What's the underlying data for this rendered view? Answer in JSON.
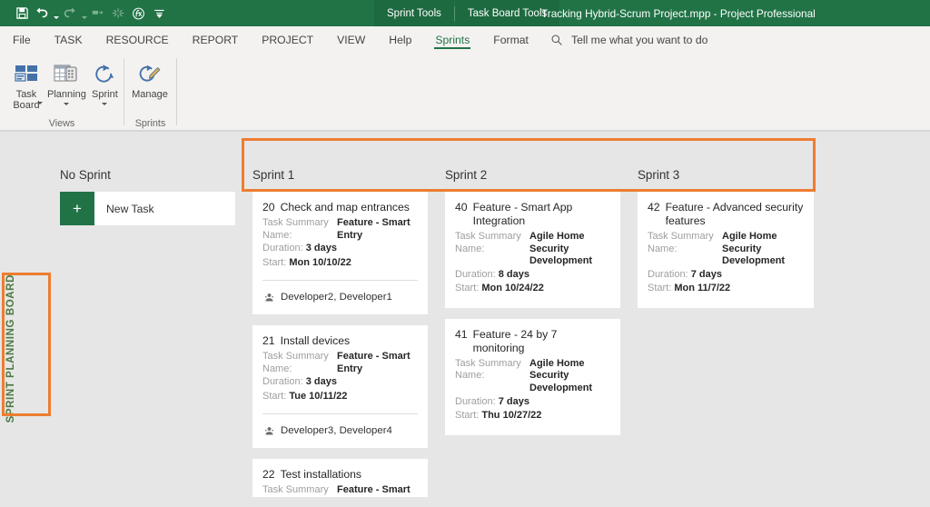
{
  "titlebar": {
    "quick_access": [
      {
        "name": "save-icon",
        "label": "Save",
        "dim": false,
        "caret": false
      },
      {
        "name": "undo-icon",
        "label": "Undo",
        "dim": false,
        "caret": true
      },
      {
        "name": "redo-icon",
        "label": "Redo",
        "dim": true,
        "caret": true
      },
      {
        "name": "link-tasks-icon",
        "label": "Link Tasks",
        "dim": true,
        "caret": false
      },
      {
        "name": "unlink-tasks-icon",
        "label": "Unlink Tasks",
        "dim": true,
        "caret": false
      },
      {
        "name": "function-icon",
        "label": "Custom Fields",
        "dim": false,
        "caret": false
      },
      {
        "name": "customize-toolbar-icon",
        "label": "Customize Quick Access Toolbar",
        "dim": false,
        "caret": false
      }
    ],
    "context_tabs": [
      "Sprint Tools",
      "Task Board Tools"
    ],
    "document_title": "Tracking Hybrid-Scrum Project.mpp  -  Project Professional"
  },
  "tabs": [
    {
      "label": "File",
      "active": false
    },
    {
      "label": "TASK",
      "active": false
    },
    {
      "label": "RESOURCE",
      "active": false
    },
    {
      "label": "REPORT",
      "active": false
    },
    {
      "label": "PROJECT",
      "active": false
    },
    {
      "label": "VIEW",
      "active": false
    },
    {
      "label": "Help",
      "active": false
    },
    {
      "label": "Sprints",
      "active": true
    },
    {
      "label": "Format",
      "active": false
    }
  ],
  "tell_me": {
    "icon": "search-icon",
    "text": "Tell me what you want to do"
  },
  "ribbon": {
    "groups": [
      {
        "label": "Views",
        "buttons": [
          {
            "label": "Task Board",
            "icon": "task-board-icon",
            "caret": true,
            "two_line": true
          },
          {
            "label": "Planning",
            "icon": "planning-icon",
            "caret": true,
            "two_line": false
          },
          {
            "label": "Sprint",
            "icon": "sprint-icon",
            "caret": true,
            "two_line": false
          }
        ]
      },
      {
        "label": "Sprints",
        "buttons": [
          {
            "label": "Manage",
            "icon": "manage-sprints-icon",
            "caret": false,
            "two_line": false
          }
        ]
      }
    ]
  },
  "board": {
    "rail_label": "SPRINT PLANNING BOARD",
    "columns": [
      {
        "title": "No Sprint",
        "new_task": {
          "label": "New Task",
          "plus": "+"
        },
        "cards": []
      },
      {
        "title": "Sprint 1",
        "cards": [
          {
            "id": "20",
            "name": "Check and map entrances",
            "summary_key": "Task Summary Name:",
            "summary_value": "Feature - Smart Entry",
            "duration_key": "Duration:",
            "duration_value": "3 days",
            "start_key": "Start:",
            "start_value": "Mon 10/10/22",
            "assignees": "Developer2, Developer1"
          },
          {
            "id": "21",
            "name": "Install devices",
            "summary_key": "Task Summary Name:",
            "summary_value": "Feature - Smart Entry",
            "duration_key": "Duration:",
            "duration_value": "3 days",
            "start_key": "Start:",
            "start_value": "Tue 10/11/22",
            "assignees": "Developer3, Developer4"
          },
          {
            "id": "22",
            "name": "Test installations",
            "summary_key": "Task Summary",
            "summary_value": "Feature - Smart",
            "duration_key": "",
            "duration_value": "",
            "start_key": "",
            "start_value": "",
            "assignees": ""
          }
        ]
      },
      {
        "title": "Sprint 2",
        "cards": [
          {
            "id": "40",
            "name": "Feature - Smart App Integration",
            "summary_key": "Task Summary Name:",
            "summary_value": "Agile Home Security Development",
            "duration_key": "Duration:",
            "duration_value": "8 days",
            "start_key": "Start:",
            "start_value": "Mon 10/24/22",
            "assignees": ""
          },
          {
            "id": "41",
            "name": "Feature - 24 by 7 monitoring",
            "summary_key": "Task Summary Name:",
            "summary_value": "Agile Home Security Development",
            "duration_key": "Duration:",
            "duration_value": "7 days",
            "start_key": "Start:",
            "start_value": "Thu 10/27/22",
            "assignees": ""
          }
        ]
      },
      {
        "title": "Sprint 3",
        "cards": [
          {
            "id": "42",
            "name": "Feature - Advanced security features",
            "summary_key": "Task Summary Name:",
            "summary_value": "Agile Home Security Development",
            "duration_key": "Duration:",
            "duration_value": "7 days",
            "start_key": "Start:",
            "start_value": "Mon 11/7/22",
            "assignees": ""
          }
        ]
      }
    ]
  },
  "annotations": {
    "accent_color": "#ED7D31",
    "boxes": [
      {
        "name": "sprint-columns-highlight"
      },
      {
        "name": "sprint-planning-board-highlight"
      }
    ]
  },
  "colors": {
    "title_bar_green": "#217346",
    "ribbon_gray": "#f3f2f1",
    "board_gray": "#e6e6e6",
    "card_white": "#ffffff",
    "rail_text_green": "#4a7a42"
  }
}
